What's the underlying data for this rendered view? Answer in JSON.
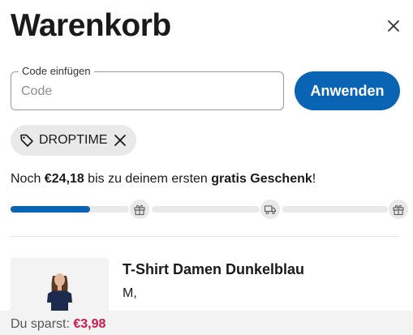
{
  "cart": {
    "title": "Warenkorb"
  },
  "coupon": {
    "label": "Code einfügen",
    "placeholder": "Code",
    "value": "",
    "apply_label": "Anwenden"
  },
  "applied_code": {
    "code": "DROPTIME",
    "tag_icon": "tag-icon",
    "remove_icon": "close-icon"
  },
  "gift_progress": {
    "msg_prefix": "Noch ",
    "amount": "€24,18",
    "msg_middle": " bis zu deinem ersten ",
    "goal": "gratis Geschenk",
    "msg_suffix": "!",
    "progress_fraction": 0.2,
    "milestone_icons": [
      "gift-icon",
      "delivery-truck-icon",
      "gift-icon"
    ]
  },
  "items": [
    {
      "name": "T-Shirt Damen Dunkelblau",
      "variant": "M,"
    }
  ],
  "savings": {
    "label": "Du sparst:",
    "amount": "€3,98"
  },
  "colors": {
    "accent": "#0a64b4",
    "savings": "#d1174e",
    "track": "#e9e9e9"
  }
}
